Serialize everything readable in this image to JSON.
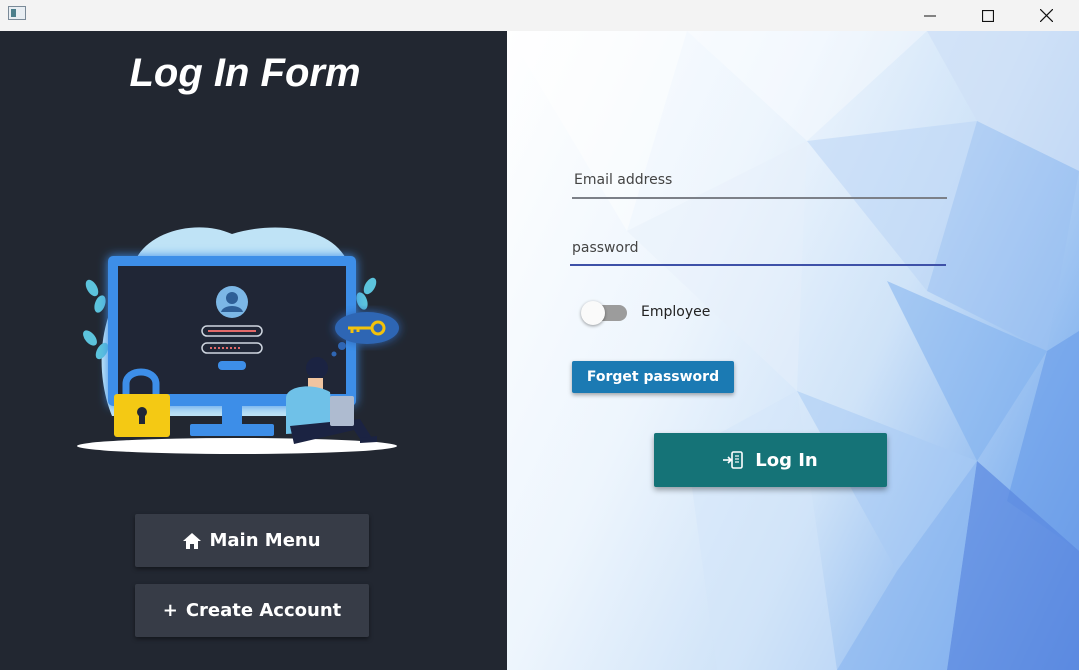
{
  "window": {
    "icon": "app-window-icon",
    "controls": {
      "minimize": "minimize-icon",
      "maximize": "maximize-icon",
      "close": "close-icon"
    }
  },
  "left": {
    "title": "Log In Form",
    "illustration": "login-computer-illustration",
    "main_menu_label": "Main Menu",
    "main_menu_icon": "home-icon",
    "create_account_label": "Create Account",
    "create_account_icon": "plus-icon",
    "create_account_symbol": "+"
  },
  "form": {
    "email_placeholder": "Email address",
    "email_value": "",
    "password_placeholder": "password",
    "password_value": "",
    "toggle_label": "Employee",
    "toggle_on": false,
    "forget_label": "Forget password",
    "login_label": "Log In",
    "login_icon": "login-device-icon"
  },
  "colors": {
    "left_bg": "#222731",
    "side_button_bg": "#373c47",
    "forget_button_bg": "#1b7ab3",
    "login_button_bg": "#157377",
    "password_underline": "#3e51a8"
  }
}
